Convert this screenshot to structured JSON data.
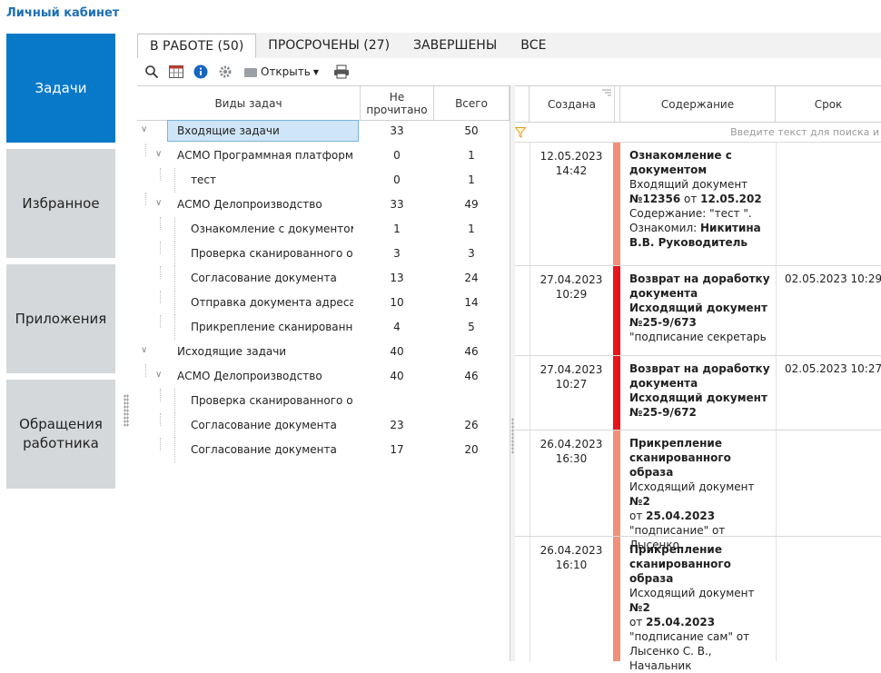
{
  "app": {
    "title": "Личный кабинет"
  },
  "nav": [
    {
      "label": "Задачи",
      "active": true
    },
    {
      "label": "Избранное",
      "active": false
    },
    {
      "label": "Приложения",
      "active": false
    },
    {
      "label": "Обращения работника",
      "active": false
    }
  ],
  "tabs": [
    {
      "label": "В РАБОТЕ (50)",
      "active": true
    },
    {
      "label": "ПРОСРОЧЕНЫ (27)",
      "active": false
    },
    {
      "label": "ЗАВЕРШЕНЫ",
      "active": false
    },
    {
      "label": "ВСЕ",
      "active": false
    }
  ],
  "toolbar": {
    "open_label": "Открыть"
  },
  "tree": {
    "headers": {
      "name": "Виды задач",
      "unread": "Не прочитано",
      "total": "Всего"
    },
    "rows": [
      {
        "name": "Входящие задачи",
        "unread": "33",
        "total": "50"
      },
      {
        "name": "АСМО Программная платформа",
        "unread": "0",
        "total": "1"
      },
      {
        "name": "тест",
        "unread": "0",
        "total": "1"
      },
      {
        "name": "АСМО Делопроизводство",
        "unread": "33",
        "total": "49"
      },
      {
        "name": "Ознакомление с документом",
        "unread": "1",
        "total": "1"
      },
      {
        "name": "Проверка сканированного обра",
        "unread": "3",
        "total": "3"
      },
      {
        "name": "Согласование документа",
        "unread": "13",
        "total": "24"
      },
      {
        "name": "Отправка документа адресату",
        "unread": "10",
        "total": "14"
      },
      {
        "name": "Прикрепление сканированного",
        "unread": "4",
        "total": "5"
      },
      {
        "name": "Исходящие задачи",
        "unread": "40",
        "total": "46"
      },
      {
        "name": "АСМО Делопроизводство",
        "unread": "40",
        "total": "46"
      },
      {
        "name": "Проверка сканированного обра",
        "unread": "",
        "total": ""
      },
      {
        "name": "Согласование документа",
        "unread": "23",
        "total": "26"
      },
      {
        "name": "Согласование документа",
        "unread": "17",
        "total": "20"
      }
    ]
  },
  "grid": {
    "headers": {
      "created": "Создана",
      "content": "Содержание",
      "deadline": "Срок"
    },
    "filter_placeholder": "Введите текст для поиска и",
    "rows": [
      {
        "date": "12.05.2023",
        "time": "14:42",
        "deadline": "",
        "status_color": "#f0907a",
        "title": "Ознакомление с документом",
        "l1": "Входящий документ",
        "l2a": "№12356",
        "l2b": " от ",
        "l2c": "12.05.202",
        "l3": "Содержание: \"тест \".",
        "l4a": "Ознакомил: ",
        "l4b": "Никитина",
        "l5": "В.В. Руководитель"
      },
      {
        "date": "27.04.2023",
        "time": "10:29",
        "deadline": "02.05.2023 10:29",
        "status_color": "#e8141c",
        "title": "Возврат на доработку документа",
        "l1": "Исходящий документ",
        "l2": "№25-9/673",
        "l3": "\"подписание секретарь"
      },
      {
        "date": "27.04.2023",
        "time": "10:27",
        "deadline": "02.05.2023 10:27",
        "status_color": "#e8141c",
        "title": "Возврат на доработку документа",
        "l1": "Исходящий документ",
        "l2": "№25-9/672"
      },
      {
        "date": "26.04.2023",
        "time": "16:30",
        "deadline": "",
        "status_color": "#f0907a",
        "title": "Прикрепление сканированного образа",
        "l1a": "Исходящий документ ",
        "l1b": "№2",
        "l2a": " от ",
        "l2b": "25.04.2023",
        "l3": "\"подписание\" от Лысенко"
      },
      {
        "date": "26.04.2023",
        "time": "16:10",
        "deadline": "",
        "status_color": "#f0907a",
        "title": "Прикрепление сканированного образа",
        "l1a": "Исходящий документ ",
        "l1b": "№2",
        "l2a": " от ",
        "l2b": "25.04.2023",
        "l3": "\"подписание сам\" от",
        "l4": "Лысенко С. В., Начальник"
      }
    ]
  }
}
